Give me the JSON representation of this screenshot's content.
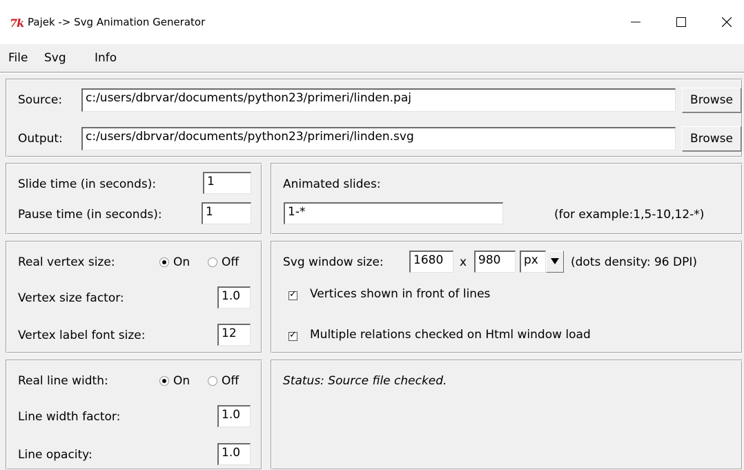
{
  "window": {
    "title": "Pajek -> Svg Animation Generator",
    "logo": "7k",
    "minimize_icon": "minimize-icon",
    "maximize_icon": "maximize-icon",
    "close_icon": "close-icon"
  },
  "menu": {
    "items": [
      "File",
      "Svg",
      "Info"
    ]
  },
  "files": {
    "source_label": "Source:",
    "source_value": "c:/users/dbrvar/documents/python23/primeri/linden.paj",
    "output_label": "Output:",
    "output_value": "c:/users/dbrvar/documents/python23/primeri/linden.svg",
    "browse_label": "Browse"
  },
  "timing": {
    "slide_label": "Slide time (in seconds):",
    "slide_value": "1",
    "pause_label": "Pause time (in seconds):",
    "pause_value": "1"
  },
  "animated": {
    "label": "Animated slides:",
    "value": "1-*",
    "example": "(for example:1,5-10,12-*)"
  },
  "vertex": {
    "real_size_label": "Real vertex size:",
    "on_label": "On",
    "off_label": "Off",
    "real_size_selected": "On",
    "size_factor_label": "Vertex size factor:",
    "size_factor_value": "1.0",
    "font_size_label": "Vertex label font size:",
    "font_size_value": "12"
  },
  "svg": {
    "window_size_label": "Svg window size:",
    "width": "1680",
    "x_label": "x",
    "height": "980",
    "unit": "px",
    "density": "(dots density: 96 DPI)",
    "vertices_front_label": "Vertices shown in front of lines",
    "vertices_front_checked": true,
    "multiple_relations_label": "Multiple relations checked on Html window load",
    "multiple_relations_checked": true
  },
  "line": {
    "real_width_label": "Real line width:",
    "on_label": "On",
    "off_label": "Off",
    "real_width_selected": "On",
    "width_factor_label": "Line width factor:",
    "width_factor_value": "1.0",
    "opacity_label": "Line opacity:",
    "opacity_value": "1.0"
  },
  "status": {
    "text": "Status: Source file checked."
  }
}
